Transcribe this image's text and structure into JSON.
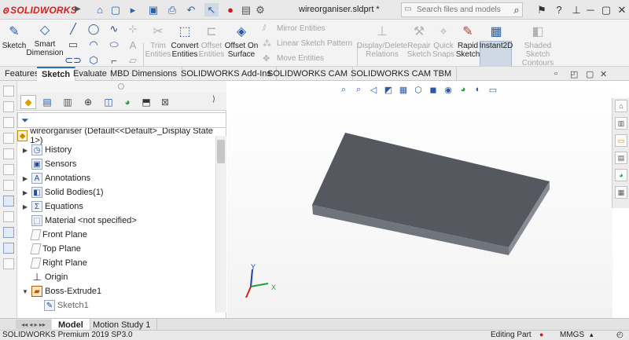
{
  "app": {
    "brand": "SOLIDWORKS",
    "document_title": "wireorganiser.sldprt *"
  },
  "search": {
    "placeholder": "Search files and models"
  },
  "title_controls": {
    "help": "?"
  },
  "ribbon": {
    "sketch": "Sketch",
    "smart_dimension": "Smart Dimension",
    "trim_entities": "Trim Entities",
    "convert_entities": "Convert Entities",
    "offset_entities": "Offset Entities",
    "offset_on_surface": "Offset On Surface",
    "mirror_entities": "Mirror Entities",
    "linear_sketch_pattern": "Linear Sketch Pattern",
    "move_entities": "Move Entities",
    "display_delete_relations": "Display/Delete Relations",
    "repair_sketch": "Repair Sketch",
    "quick_snaps": "Quick Snaps",
    "rapid_sketch": "Rapid Sketch",
    "instant2d": "Instant2D",
    "shaded_sketch_contours": "Shaded Sketch Contours"
  },
  "command_tabs": [
    {
      "label": "Features"
    },
    {
      "label": "Sketch"
    },
    {
      "label": "Evaluate"
    },
    {
      "label": "MBD Dimensions"
    },
    {
      "label": "SOLIDWORKS Add-Ins"
    },
    {
      "label": "SOLIDWORKS CAM"
    },
    {
      "label": "SOLIDWORKS CAM TBM"
    }
  ],
  "feature_tree": {
    "root": "wireorganiser  (Default<<Default>_Display State 1>)",
    "items": [
      {
        "label": "History"
      },
      {
        "label": "Sensors"
      },
      {
        "label": "Annotations"
      },
      {
        "label": "Solid Bodies(1)"
      },
      {
        "label": "Equations"
      },
      {
        "label": "Material <not specified>"
      },
      {
        "label": "Front Plane"
      },
      {
        "label": "Top Plane"
      },
      {
        "label": "Right Plane"
      },
      {
        "label": "Origin"
      },
      {
        "label": "Boss-Extrude1"
      },
      {
        "label": "Sketch1"
      }
    ]
  },
  "triad": {
    "y": "Y",
    "x": "X"
  },
  "bottom_tabs": [
    {
      "label": "Model"
    },
    {
      "label": "Motion Study 1"
    }
  ],
  "status": {
    "version": "SOLIDWORKS Premium 2019 SP3.0",
    "mode": "Editing Part",
    "units": "MMGS"
  },
  "colors": {
    "brand_red": "#d21f1f",
    "part_top": "#55585f",
    "part_front": "#717680",
    "part_side": "#8a8f99"
  }
}
